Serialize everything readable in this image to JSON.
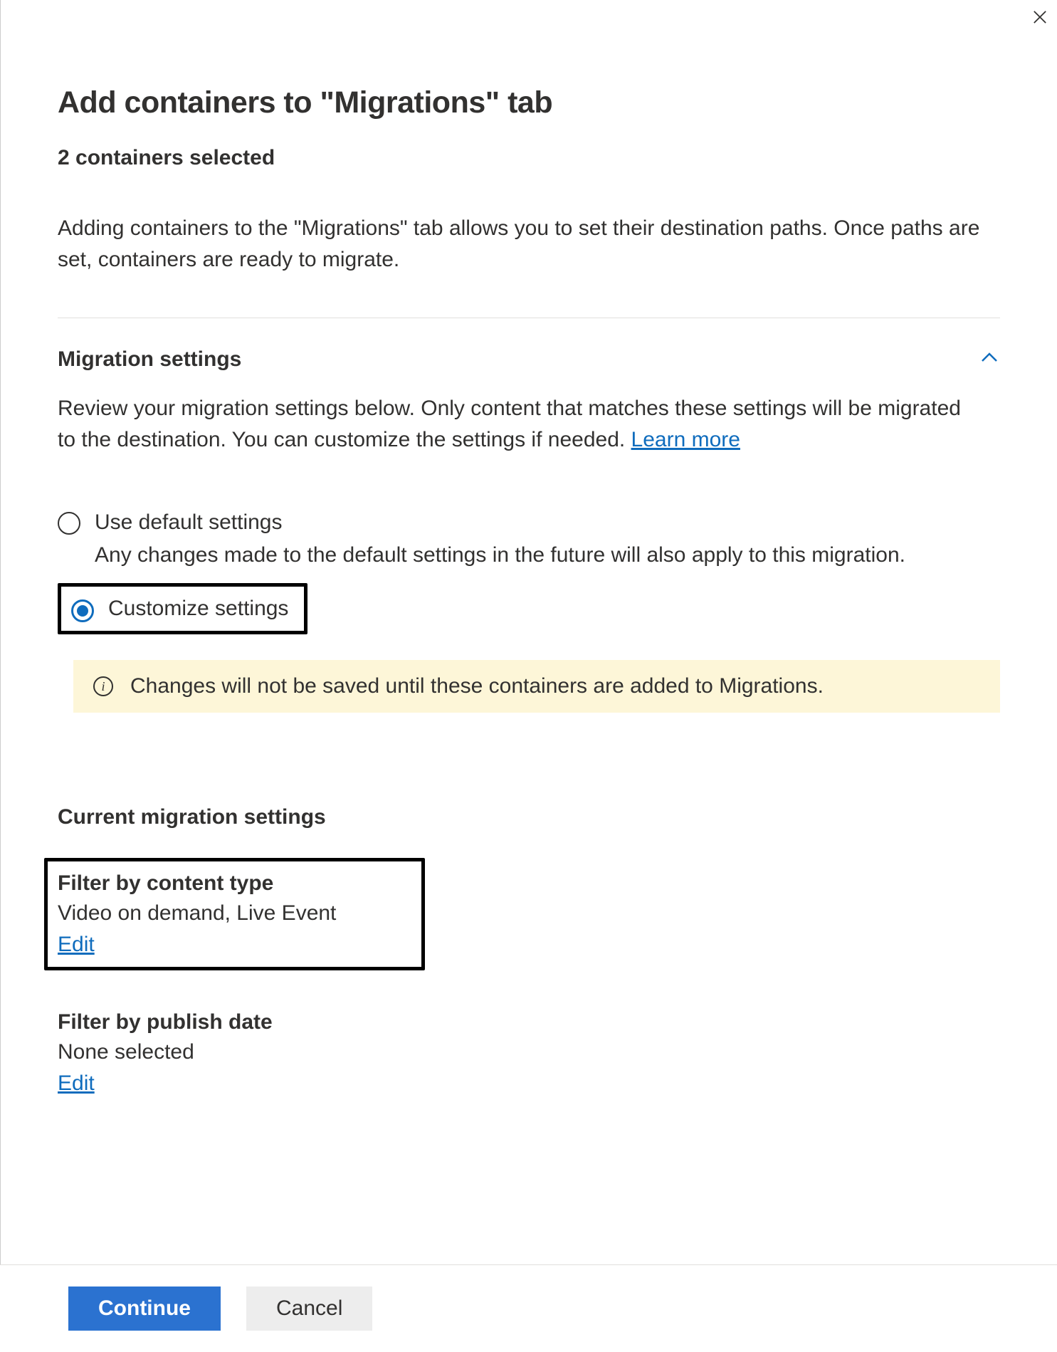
{
  "header": {
    "title": "Add containers to \"Migrations\" tab",
    "subtitle": "2 containers selected",
    "description": "Adding containers to the \"Migrations\" tab allows you to set their destination paths. Once paths are set, containers are ready to migrate."
  },
  "section": {
    "title": "Migration settings",
    "body_prefix": "Review your migration settings below. Only content that matches these settings will be migrated to the destination. You can customize the settings if needed. ",
    "learn_more": "Learn more"
  },
  "radios": {
    "default_label": "Use default settings",
    "default_help": "Any changes made to the default settings in the future will also apply to this migration.",
    "custom_label": "Customize settings"
  },
  "info_banner": "Changes will not be saved until these containers are added to Migrations.",
  "current": {
    "heading": "Current migration settings",
    "items": [
      {
        "title": "Filter by content type",
        "value": "Video on demand, Live Event",
        "edit": "Edit"
      },
      {
        "title": "Filter by publish date",
        "value": "None selected",
        "edit": "Edit"
      }
    ]
  },
  "footer": {
    "continue": "Continue",
    "cancel": "Cancel"
  },
  "colors": {
    "accent": "#0f6cbd",
    "banner_bg": "#fdf6d8"
  }
}
